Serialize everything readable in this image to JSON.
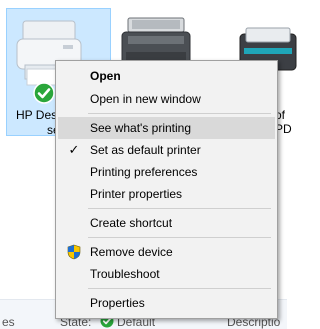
{
  "devices": {
    "selected": {
      "label_line1": "HP Des",
      "label_line2": "se",
      "status_icon": "green-checkmark-icon",
      "icon": "printer-icon"
    },
    "middle": {
      "icon": "multifunction-printer-icon"
    },
    "right": {
      "icon": "printer-icon",
      "label_line1": "of",
      "label_line2": "PD"
    }
  },
  "context_menu": {
    "items": [
      {
        "label": "Open",
        "bold": true
      },
      {
        "label": "Open in new window"
      },
      {
        "label": "See what's printing",
        "highlight": true
      },
      {
        "label": "Set as default printer",
        "checked": true,
        "check_glyph": "✓"
      },
      {
        "label": "Printing preferences"
      },
      {
        "label": "Printer properties"
      },
      {
        "label": "Create shortcut"
      },
      {
        "label": "Remove device",
        "icon": "uac-shield-icon"
      },
      {
        "label": "Troubleshoot"
      },
      {
        "label": "Properties"
      }
    ]
  },
  "details_bar": {
    "left_fragment": "es",
    "state_label": "State:",
    "state_value": "Default",
    "description_label": "Descriptio"
  },
  "colors": {
    "selection_fill": "#cce8ff",
    "selection_border": "#99d1ff",
    "menu_bg": "#f2f2f2",
    "menu_hover": "#d9d9d9",
    "status_green": "#2aa63b"
  }
}
